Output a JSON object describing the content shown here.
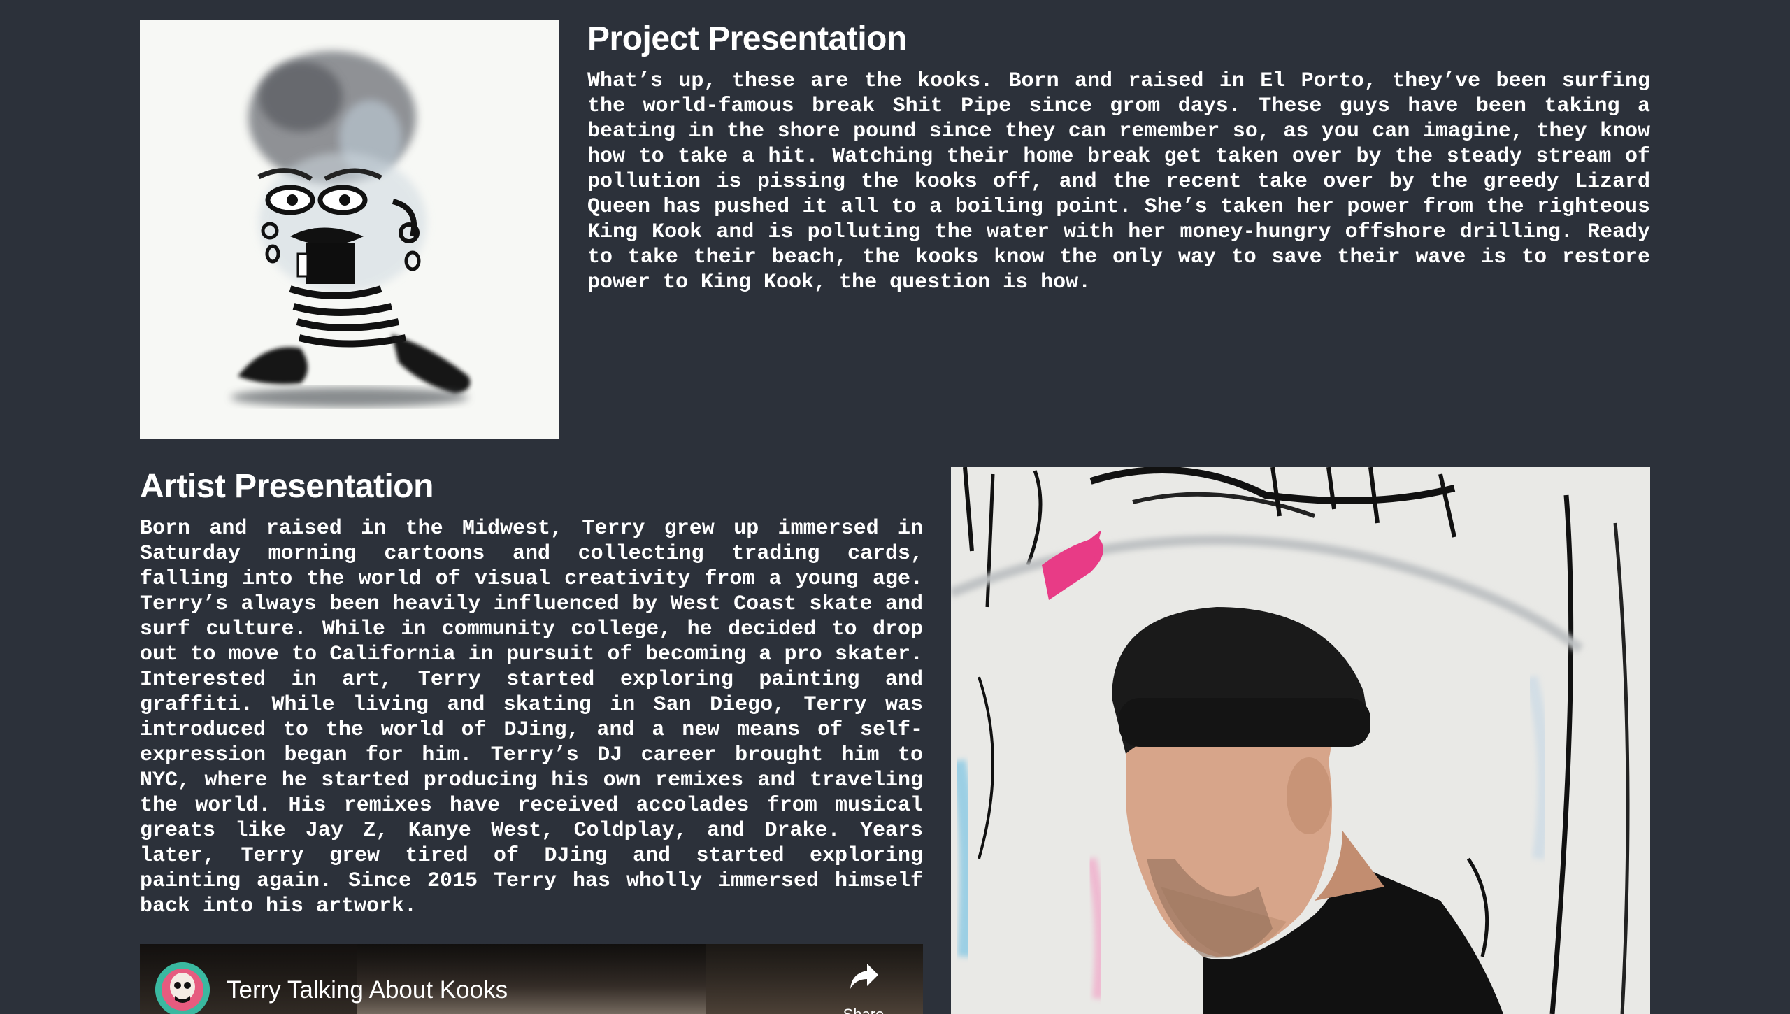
{
  "project": {
    "heading": "Project Presentation",
    "body": "What’s up, these are the kooks. Born and raised in El Porto, they’ve been surfing the world-famous break Shit Pipe since grom days. These guys have been taking a beating in the shore pound since they can remember so, as you can imagine, they know how to take a hit. Watching their home break get taken over by the steady stream of pollution is pissing the kooks off, and the recent take over by the greedy Lizard Queen has pushed it all to a boiling point. She’s taken her power from the righteous King Kook and is polluting the water with her money-hungry offshore drilling. Ready to take their beach, the kooks know the only way to save their wave is to restore power to King Kook, the question is how."
  },
  "artist": {
    "heading": "Artist Presentation",
    "body": "Born and raised in the Midwest, Terry grew up immersed in Saturday morning cartoons and collecting trading cards, falling into the world of visual creativity from a young age. Terry’s always been heavily influenced by West Coast skate and surf culture. While in community college, he decided to drop out to move to California in pursuit of becoming a pro skater. Interested in art, Terry started exploring painting and graffiti. While living and skating in San Diego, Terry was introduced to the world of DJing, and a new means of self-expression began for him. Terry’s DJ career brought him to NYC, where he started producing his own remixes and traveling the world. His remixes have received accolades from musical greats like Jay Z, Kanye West, Coldplay, and Drake. Years later, Terry grew tired of DJing and started exploring painting again. Since 2015 Terry has wholly immersed himself back into his artwork."
  },
  "video": {
    "title": "Terry Talking About Kooks",
    "share_label": "Share"
  },
  "colors": {
    "page_background": "#2c313a",
    "text": "#ffffff",
    "avatar_ring": "#3ab8a0"
  }
}
